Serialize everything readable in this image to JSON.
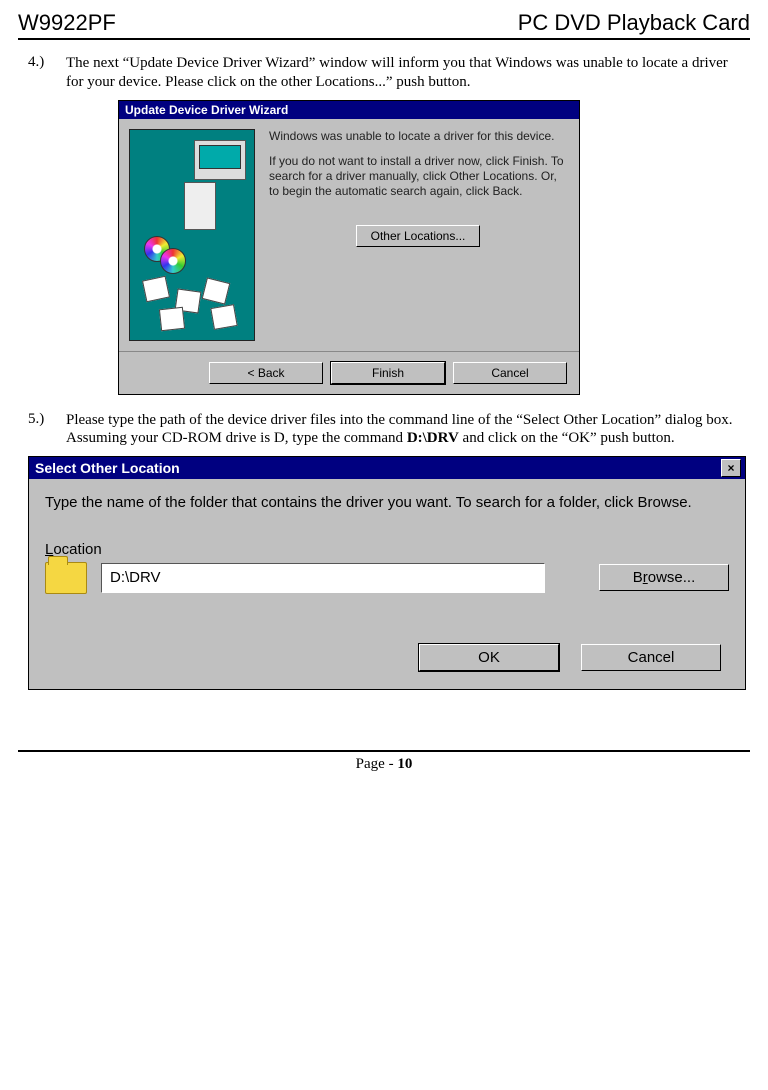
{
  "header": {
    "left": "W9922PF",
    "right": "PC DVD Playback Card"
  },
  "step4": {
    "num": "4.)",
    "text": "The next “Update Device Driver Wizard” window will inform you that Windows was unable to locate a driver for your device. Please click on the other Locations...” push button."
  },
  "dlg1": {
    "title": "Update Device Driver Wizard",
    "line1": "Windows was unable to locate a driver for this device.",
    "line2": "If you do not want to install a driver now, click Finish. To search for a driver manually, click Other Locations. Or, to begin the automatic search again, click Back.",
    "btn_other": "Other Locations...",
    "btn_back": "< Back",
    "btn_finish": "Finish",
    "btn_cancel": "Cancel"
  },
  "step5": {
    "num": "5.)",
    "pre": "Please type the path of the device driver files into the command line of the “Select Other Location” dialog box. Assuming your CD-ROM drive is D, type the command ",
    "bold": "D:\\DRV",
    "post": " and click on the “OK” push button."
  },
  "dlg2": {
    "title": "Select Other Location",
    "close": "×",
    "instr": "Type the name of the folder that contains the driver you want. To search for a folder, click Browse.",
    "loc_label": "Location",
    "loc_value": "D:\\DRV",
    "browse_pre": "B",
    "browse_u": "r",
    "browse_post": "owse...",
    "ok": "OK",
    "cancel": "Cancel"
  },
  "footer": {
    "page_pre": "Page - ",
    "page_num": "10"
  }
}
